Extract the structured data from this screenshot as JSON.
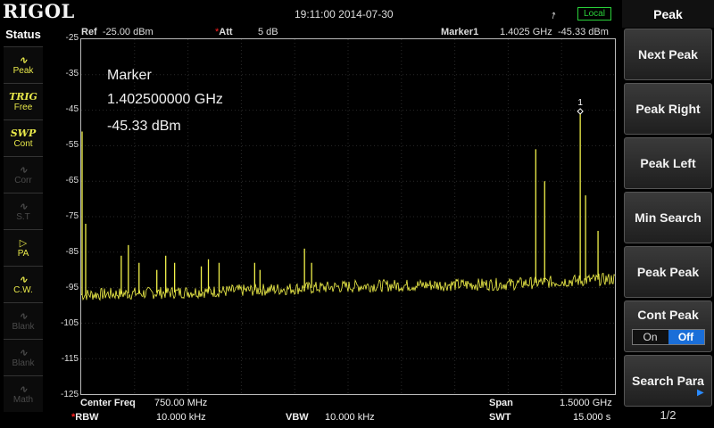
{
  "brand": "RIGOL",
  "datetime": "19:11:00 2014-07-30",
  "local_badge": "Local",
  "status": {
    "title": "Status",
    "items": [
      {
        "icon": "peak-icon",
        "glyph": "∿",
        "label": "Peak",
        "active": true
      },
      {
        "icon": "trig-icon",
        "glyph": "TRIG",
        "label": "Free",
        "active": true
      },
      {
        "icon": "sweep-icon",
        "glyph": "SWP",
        "label": "Cont",
        "active": true
      },
      {
        "icon": "corr-icon",
        "glyph": "∿",
        "label": "Corr",
        "active": false
      },
      {
        "icon": "st-icon",
        "glyph": "∿",
        "label": "S.T",
        "active": false
      },
      {
        "icon": "pa-icon",
        "glyph": "▷",
        "label": "PA",
        "active": true
      },
      {
        "icon": "cw-icon",
        "glyph": "∿",
        "label": "C.W.",
        "active": true
      },
      {
        "icon": "blank-icon",
        "glyph": "∿",
        "label": "Blank",
        "active": false
      },
      {
        "icon": "blank-icon",
        "glyph": "∿",
        "label": "Blank",
        "active": false
      },
      {
        "icon": "math-icon",
        "glyph": "∿",
        "label": "Math",
        "active": false
      }
    ]
  },
  "header": {
    "ref_label": "Ref",
    "ref_value": "-25.00 dBm",
    "att_label": "Att",
    "att_value": "5 dB",
    "marker_label": "Marker1",
    "marker_freq": "1.4025 GHz",
    "marker_amp": "-45.33 dBm"
  },
  "marker_readout": {
    "title": "Marker",
    "freq": "1.402500000 GHz",
    "amp": "-45.33 dBm",
    "number": "1"
  },
  "y_ticks": [
    "-25",
    "-35",
    "-45",
    "-55",
    "-65",
    "-75",
    "-85",
    "-95",
    "-105",
    "-115",
    "-125"
  ],
  "footer": {
    "center_label": "Center Freq",
    "center_value": "750.00 MHz",
    "span_label": "Span",
    "span_value": "1.5000 GHz",
    "rbw_label": "RBW",
    "rbw_value": "10.000 kHz",
    "vbw_label": "VBW",
    "vbw_value": "10.000 kHz",
    "swt_label": "SWT",
    "swt_value": "15.000 s"
  },
  "menu": {
    "title": "Peak",
    "keys": [
      "Next Peak",
      "Peak Right",
      "Peak Left",
      "Min Search",
      "Peak Peak"
    ],
    "cont_peak": {
      "label": "Cont Peak",
      "on": "On",
      "off": "Off",
      "selected": "Off"
    },
    "search_para": "Search Para",
    "page": "1/2"
  },
  "colors": {
    "trace": "#f2f24a",
    "accent": "#1a6ed8",
    "local": "#2ad13a"
  },
  "chart_data": {
    "type": "line",
    "xlim": [
      0,
      1.5
    ],
    "ylim": [
      -125,
      -25
    ],
    "ylabel": "",
    "xlabel": "",
    "noise_floor": [
      [
        0,
        -97
      ],
      [
        0.4,
        -96
      ],
      [
        0.8,
        -94.5
      ],
      [
        1.2,
        -94
      ],
      [
        1.5,
        -92.5
      ]
    ],
    "peaks": [
      {
        "x": 0.0025,
        "y": -51
      },
      {
        "x": 0.0125,
        "y": -77
      },
      {
        "x": 0.1125,
        "y": -86
      },
      {
        "x": 0.1325,
        "y": -83
      },
      {
        "x": 0.1625,
        "y": -88
      },
      {
        "x": 0.2125,
        "y": -90
      },
      {
        "x": 0.2375,
        "y": -86
      },
      {
        "x": 0.2625,
        "y": -88
      },
      {
        "x": 0.3375,
        "y": -89
      },
      {
        "x": 0.3575,
        "y": -87
      },
      {
        "x": 0.3875,
        "y": -88
      },
      {
        "x": 0.4875,
        "y": -88
      },
      {
        "x": 0.5025,
        "y": -90
      },
      {
        "x": 0.6275,
        "y": -84
      },
      {
        "x": 0.6475,
        "y": -88
      },
      {
        "x": 1.2775,
        "y": -56
      },
      {
        "x": 1.3025,
        "y": -65
      },
      {
        "x": 1.4025,
        "y": -45.33
      },
      {
        "x": 1.4175,
        "y": -69
      },
      {
        "x": 1.4525,
        "y": -79
      }
    ],
    "marker": {
      "x": 1.4025,
      "y": -45.33
    }
  }
}
